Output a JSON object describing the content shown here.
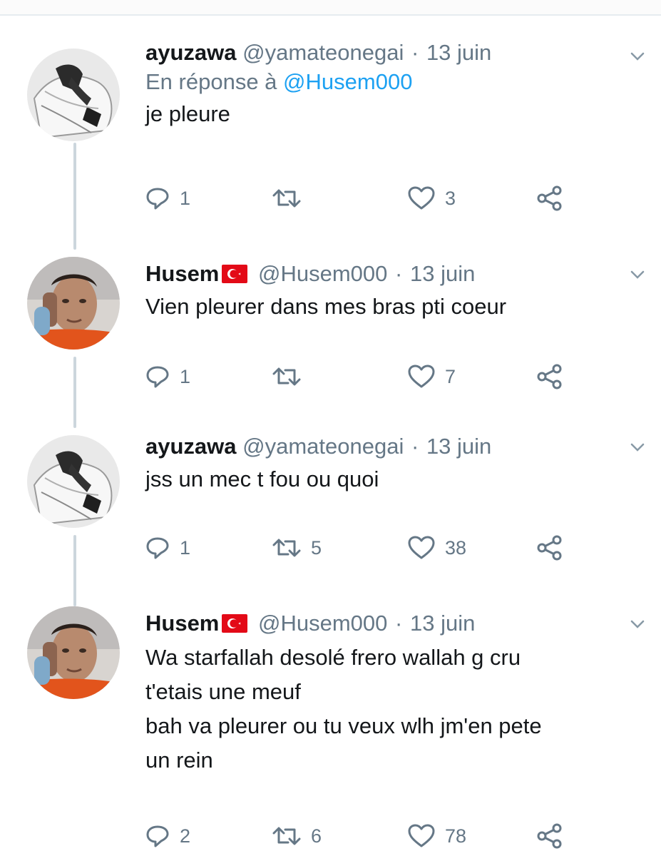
{
  "tweets": [
    {
      "name": "ayuzawa",
      "handle": "@yamateonegai",
      "separator": "·",
      "date": "13 juin",
      "has_flag": false,
      "reply_prefix": "En réponse à",
      "reply_mention": "@Husem000",
      "lines": [
        "je pleure"
      ],
      "replies": "1",
      "retweets": "",
      "likes": "3",
      "avatar": "anime-avatar"
    },
    {
      "name": "Husem",
      "handle": "@Husem000",
      "separator": "·",
      "date": "13 juin",
      "has_flag": true,
      "lines": [
        "Vien pleurer dans mes bras pti coeur"
      ],
      "replies": "1",
      "retweets": "",
      "likes": "7",
      "avatar": "photo-avatar"
    },
    {
      "name": "ayuzawa",
      "handle": "@yamateonegai",
      "separator": "·",
      "date": "13 juin",
      "has_flag": false,
      "lines": [
        "jss un mec t fou ou quoi"
      ],
      "replies": "1",
      "retweets": "5",
      "likes": "38",
      "avatar": "anime-avatar"
    },
    {
      "name": "Husem",
      "handle": "@Husem000",
      "separator": "·",
      "date": "13 juin",
      "has_flag": true,
      "lines": [
        "Wa starfallah desolé frero wallah g cru",
        "t'etais une meuf",
        "bah va pleurer ou tu veux wlh jm'en pete",
        "un rein"
      ],
      "replies": "2",
      "retweets": "6",
      "likes": "78",
      "avatar": "photo-avatar"
    }
  ],
  "icons": {
    "reply": "reply-icon",
    "retweet": "retweet-icon",
    "like": "heart-icon",
    "share": "share-icon",
    "caret": "chevron-down-icon",
    "flag": "turkey-flag-icon"
  },
  "colors": {
    "text": "#14171a",
    "muted": "#657786",
    "link": "#1da1f2",
    "thread_line": "#ccd6dd",
    "flag_red": "#e30a17"
  }
}
